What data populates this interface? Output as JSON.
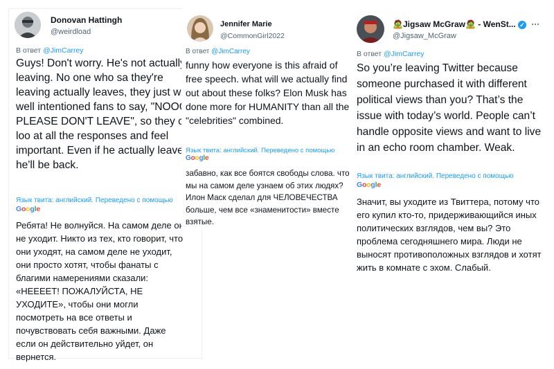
{
  "tweets": [
    {
      "name": "Donovan Hattingh",
      "handle": "@weirdload",
      "reply_prefix": "В ответ",
      "mention": "@JimCarrey",
      "text": "Guys! Don't worry. He's not actually leaving. No one who sa they're leaving actually leaves, they just want well intentioned fans to say, \"NOOO! PLEASE DON'T LEAVE\", so they can loo at all the responses and feel important. Even if he actually leaves, he'll be back.",
      "lang_note": "Язык твита: английский. Переведено с помощью",
      "google": "Google",
      "translation": "Ребята! Не волнуйся. На самом деле он не уходит. Никто из тех, кто говорит, что они уходят, на самом деле не уходит, они просто хотят, чтобы фанаты с благими намерениями сказали: «НЕЕЕЕТ! ПОЖАЛУЙСТА, НЕ УХОДИТЕ», чтобы они могли посмотреть на все ответы и почувствовать себя важными. Даже если он действительно уйдет, он вернется."
    },
    {
      "name": "Jennifer Marie",
      "handle": "@CommonGirl2022",
      "reply_prefix": "В ответ",
      "mention": "@JimCarrey",
      "text": "funny how everyone is this afraid of free speech.  what will we actually find out about these folks? Elon Musk has done more for HUMANITY than all the \"celebrities\" combined.",
      "lang_note": "Язык твита: английский. Переведено с помощью",
      "google": "Google",
      "translation": "забавно, как все боятся свободы слова. что мы на самом деле узнаем об этих людях? Илон Маск сделал для ЧЕЛОВЕЧЕСТВА больше, чем все «знаменитости» вместе взятые."
    },
    {
      "name": "🧟Jigsaw McGraw🧟 - WenSt...",
      "handle": "@Jigsaw_McGraw",
      "reply_prefix": "В ответ",
      "mention": "@JimCarrey",
      "text": "So you’re leaving Twitter because someone purchased it with different political views than you? That’s the issue with today’s world. People can’t handle opposite views and want to live in an echo room chamber. Weak.",
      "lang_note": "Язык твита: английский. Переведено с помощью",
      "google": "Google",
      "translation": "Значит, вы уходите из Твиттера, потому что его купил кто-то, придерживающийся иных политических взглядов, чем вы? Это проблема сегодняшнего мира. Люди не выносят противоположных взглядов и хотят жить в комнате с эхом. Слабый."
    }
  ],
  "colors": {
    "link": "#1d9bf0",
    "muted": "#536471",
    "text": "#0f1419",
    "verified": "#1d9bf0"
  }
}
